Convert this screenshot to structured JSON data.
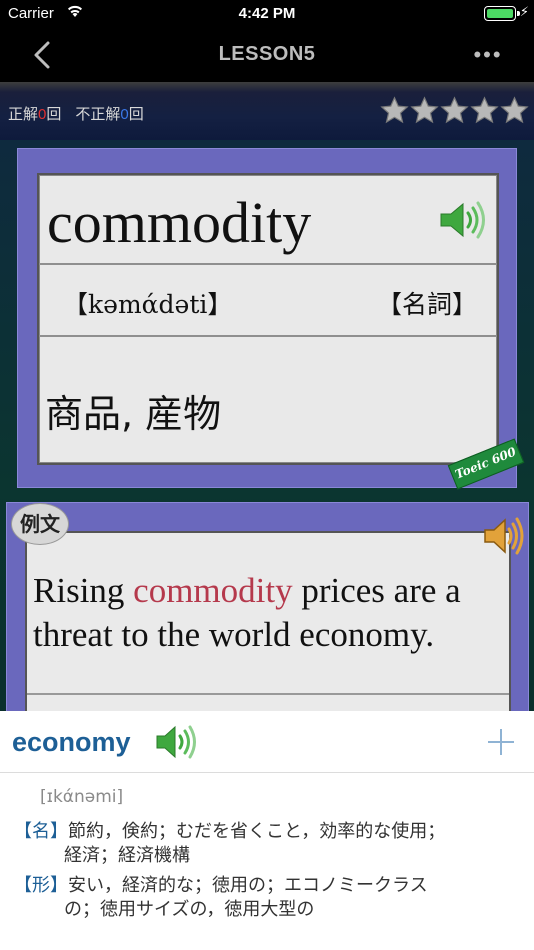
{
  "status_bar": {
    "carrier": "Carrier",
    "time": "4:42 PM",
    "battery_level": 1.0
  },
  "nav": {
    "title": "LESSON5",
    "more": "•••"
  },
  "score": {
    "correct_label": "正解",
    "correct_count": "0",
    "correct_suffix": "回",
    "incorrect_label": "不正解",
    "incorrect_count": "0",
    "incorrect_suffix": "回",
    "rating": 0,
    "max_rating": 5
  },
  "card": {
    "word": "commodity",
    "pronunciation": "【kəmάdəti】",
    "part_of_speech": "【名詞】",
    "meaning": "商品, 産物",
    "badge": "Toeic 600"
  },
  "example": {
    "badge": "例文",
    "before": "Rising ",
    "highlight": "commodity",
    "after": " prices are a threat to the world economy."
  },
  "dictionary": {
    "word": "economy",
    "pronunciation": "[ɪkάnəmi]",
    "definitions": [
      {
        "tag": "【名】",
        "line1": "節約，倹約；むだを省くこと，効率的な使用；",
        "line2": "経済；経済機構"
      },
      {
        "tag": "【形】",
        "line1": "安い，経済的な；徳用の；エコノミークラス",
        "line2": "の；徳用サイズの，徳用大型の"
      }
    ]
  },
  "colors": {
    "accent_blue": "#1d5f96",
    "highlight_red": "#b5394c",
    "card_purple": "#6a68bd",
    "badge_green": "#1f8a3c"
  },
  "icons": [
    "wifi-icon",
    "battery-icon",
    "back-chevron-icon",
    "more-icon",
    "star-icon",
    "speaker-icon",
    "plus-icon"
  ]
}
